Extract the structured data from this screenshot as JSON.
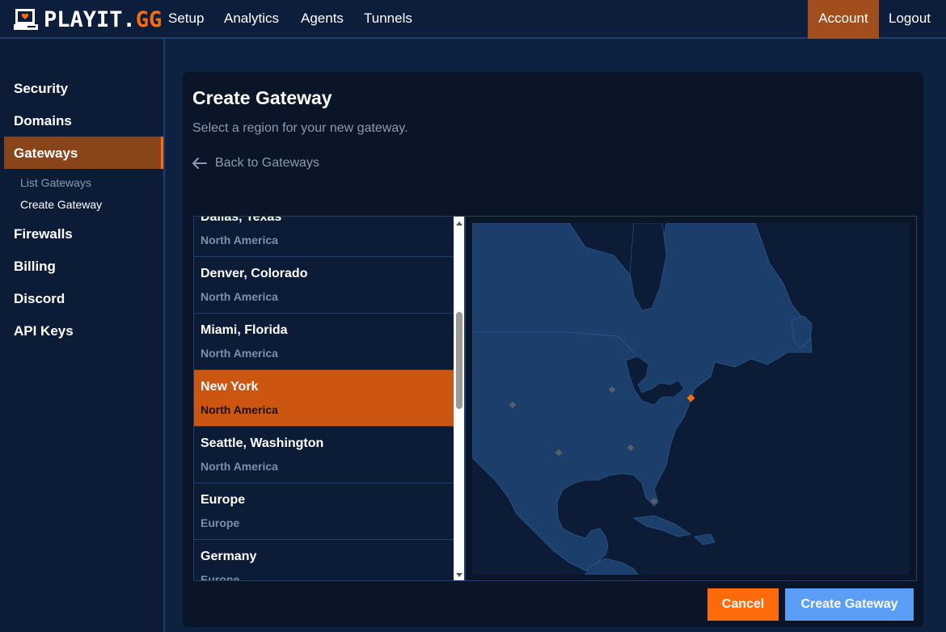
{
  "brand": {
    "name_main": "PLAYIT.",
    "name_accent": "GG",
    "accent_color": "#ff6b0a"
  },
  "nav": {
    "items": [
      {
        "label": "Setup"
      },
      {
        "label": "Analytics"
      },
      {
        "label": "Agents"
      },
      {
        "label": "Tunnels"
      }
    ],
    "account_label": "Account",
    "logout_label": "Logout"
  },
  "sidebar": {
    "items": [
      {
        "label": "Security"
      },
      {
        "label": "Domains"
      },
      {
        "label": "Gateways",
        "active": true
      },
      {
        "label": "Firewalls"
      },
      {
        "label": "Billing"
      },
      {
        "label": "Discord"
      },
      {
        "label": "API Keys"
      }
    ],
    "sub_items": [
      {
        "label": "List Gateways"
      },
      {
        "label": "Create Gateway",
        "active": true
      }
    ]
  },
  "page": {
    "title": "Create Gateway",
    "subtitle": "Select a region for your new gateway.",
    "back_label": "Back to Gateways"
  },
  "regions": [
    {
      "name": "Dallas, Texas",
      "continent": "North America"
    },
    {
      "name": "Denver, Colorado",
      "continent": "North America"
    },
    {
      "name": "Miami, Florida",
      "continent": "North America"
    },
    {
      "name": "New York",
      "continent": "North America",
      "selected": true
    },
    {
      "name": "Seattle, Washington",
      "continent": "North America"
    },
    {
      "name": "Europe",
      "continent": "Europe"
    },
    {
      "name": "Germany",
      "continent": "Europe"
    }
  ],
  "map": {
    "land_color": "#1b3f6a",
    "water_color": "#0c1c37",
    "marker_color": "#5a5f66",
    "selected_marker_color": "#ff6b0a"
  },
  "actions": {
    "cancel_label": "Cancel",
    "create_label": "Create Gateway"
  }
}
